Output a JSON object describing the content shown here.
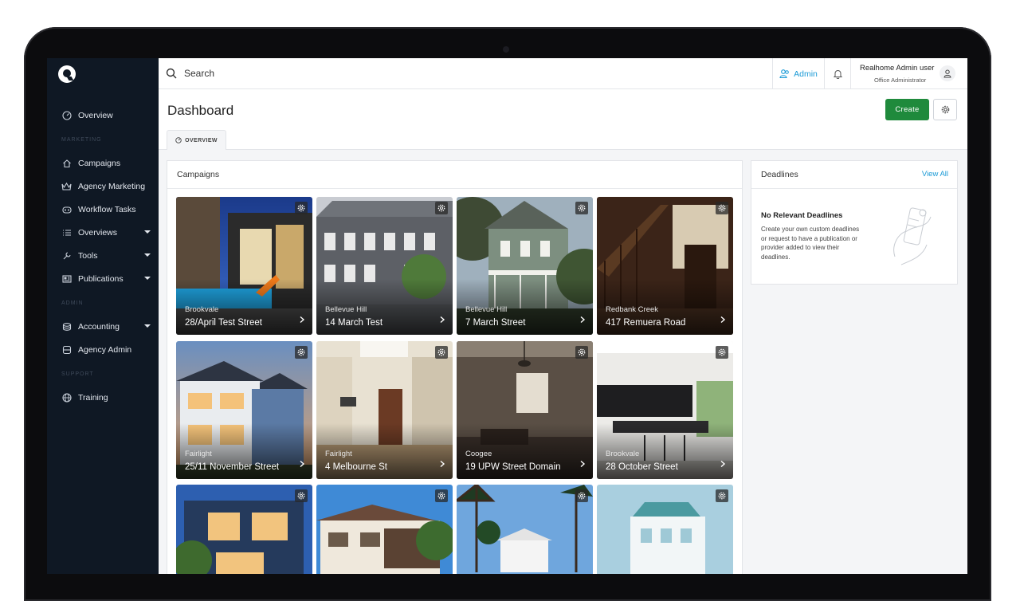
{
  "sidebar": {
    "items": [
      {
        "label": "Overview",
        "icon": "speedometer-icon"
      },
      {
        "label": "Campaigns",
        "icon": "home-icon"
      },
      {
        "label": "Agency Marketing",
        "icon": "crown-icon"
      },
      {
        "label": "Workflow Tasks",
        "icon": "workflow-icon"
      },
      {
        "label": "Overviews",
        "icon": "list-icon"
      },
      {
        "label": "Tools",
        "icon": "wrench-icon"
      },
      {
        "label": "Publications",
        "icon": "newspaper-icon"
      },
      {
        "label": "Accounting",
        "icon": "coins-icon"
      },
      {
        "label": "Agency Admin",
        "icon": "database-icon"
      },
      {
        "label": "Training",
        "icon": "globe-icon"
      }
    ],
    "sections": {
      "marketing": "MARKETING",
      "admin": "ADMIN",
      "support": "SUPPORT"
    }
  },
  "topbar": {
    "search_placeholder": "Search",
    "admin_label": "Admin",
    "user_name": "Realhome Admin user",
    "user_role": "Office Administrator"
  },
  "header": {
    "title": "Dashboard",
    "create_label": "Create",
    "tab_overview": "OVERVIEW"
  },
  "campaigns": {
    "title": "Campaigns",
    "cards": [
      {
        "suburb": "Brookvale",
        "street": "28/April Test Street"
      },
      {
        "suburb": "Bellevue Hill",
        "street": "14 March Test"
      },
      {
        "suburb": "Bellevue Hill",
        "street": "7 March Street"
      },
      {
        "suburb": "Redbank Creek",
        "street": "417 Remuera Road"
      },
      {
        "suburb": "Fairlight",
        "street": "25/11 November Street"
      },
      {
        "suburb": "Fairlight",
        "street": "4 Melbourne St"
      },
      {
        "suburb": "Coogee",
        "street": "19 UPW Street Domain"
      },
      {
        "suburb": "Brookvale",
        "street": "28 October Street"
      },
      {
        "suburb": "",
        "street": ""
      },
      {
        "suburb": "",
        "street": ""
      },
      {
        "suburb": "",
        "street": ""
      },
      {
        "suburb": "",
        "street": ""
      }
    ]
  },
  "deadlines": {
    "title": "Deadlines",
    "view_all": "View All",
    "empty_title": "No Relevant Deadlines",
    "empty_body": "Create your own custom deadlines or request to have a publication or provider added to view their deadlines."
  },
  "colors": {
    "sidebar_bg": "#0f1824",
    "accent_blue": "#1a9ad6",
    "create_green": "#1f8a3c"
  }
}
